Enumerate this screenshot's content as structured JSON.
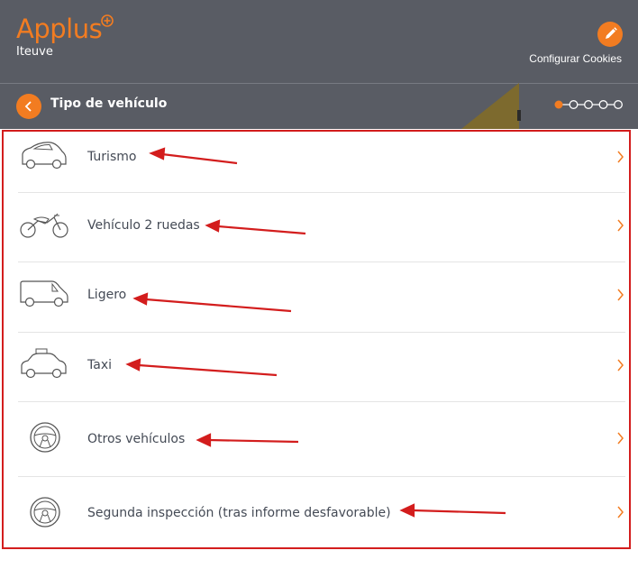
{
  "header": {
    "logo_text": "Applus",
    "brand_sub": "Iteuve",
    "cookies_label": "Configurar Cookies",
    "accent_color": "#f27c21",
    "bar_color": "#595c64"
  },
  "subheader": {
    "title": "Tipo de vehículo",
    "steps_total": 5,
    "steps_current": 1
  },
  "vehicle_types": [
    {
      "label": "Turismo",
      "icon": "car-icon"
    },
    {
      "label": "Vehículo 2 ruedas",
      "icon": "motorcycle-icon"
    },
    {
      "label": "Ligero",
      "icon": "van-icon"
    },
    {
      "label": "Taxi",
      "icon": "taxi-icon"
    },
    {
      "label": "Otros vehículos",
      "icon": "steering-wheel-icon"
    },
    {
      "label": "Segunda inspección (tras informe desfavorable)",
      "icon": "steering-wheel-icon"
    }
  ],
  "annotation_color": "#d31d1d"
}
